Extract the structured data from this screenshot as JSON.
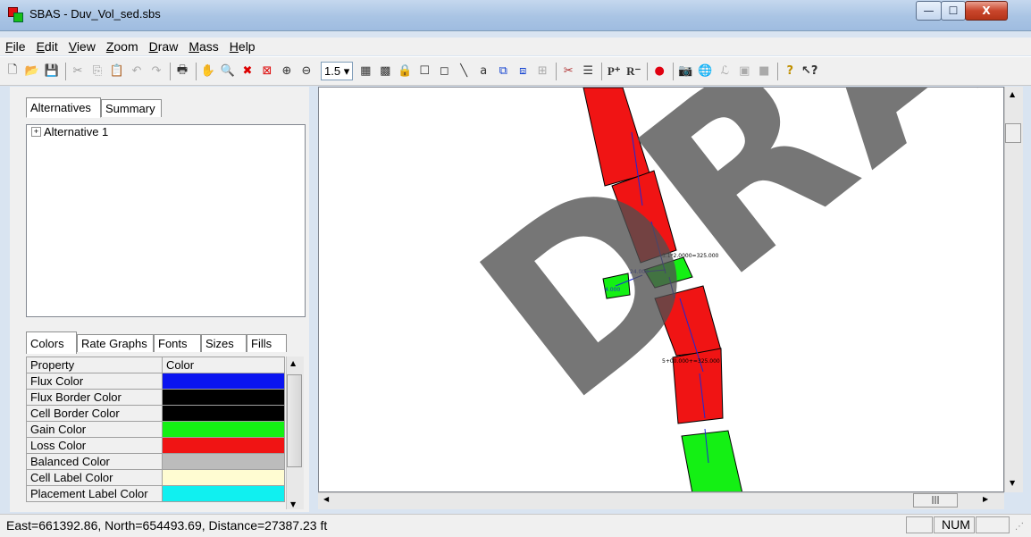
{
  "window": {
    "title": "SBAS - Duv_Vol_sed.sbs",
    "minimize_label": "—",
    "maximize_label": "☐",
    "close_label": "X"
  },
  "menu": [
    "File",
    "Edit",
    "View",
    "Zoom",
    "Draw",
    "Mass",
    "Help"
  ],
  "toolbar": {
    "zoom_value": "1.5",
    "tool_labels": {
      "text_tool": "a",
      "p_plus": "P⁺",
      "r_minus": "R⁻"
    }
  },
  "left_panel": {
    "top_tabs": [
      "Alternatives",
      "Summary"
    ],
    "tree": {
      "root": "Alternative 1",
      "expander": "+"
    },
    "bottom_tabs": [
      "Colors",
      "Rate Graphs",
      "Fonts",
      "Sizes",
      "Fills"
    ],
    "table_headers": [
      "Property",
      "Color"
    ],
    "rows": [
      {
        "property": "Flux Color",
        "color": "#0a14f0"
      },
      {
        "property": "Flux Border Color",
        "color": "#000000"
      },
      {
        "property": "Cell Border Color",
        "color": "#000000"
      },
      {
        "property": "Gain Color",
        "color": "#14f014"
      },
      {
        "property": "Loss Color",
        "color": "#f01414"
      },
      {
        "property": "Balanced Color",
        "color": "#bcbcbc"
      },
      {
        "property": "Cell Label Color",
        "color": "#fffcd2"
      },
      {
        "property": "Placement Label Color",
        "color": "#10f0f0"
      }
    ]
  },
  "canvas": {
    "cell_labels": [
      "3.1*2.0000=325.000",
      "5+00.000+=325.000",
      "24.000",
      "4.000"
    ],
    "watermark": "DRAFT"
  },
  "status": {
    "coords": "East=661392.86, North=654493.69, Distance=27387.23 ft",
    "num": "NUM"
  },
  "colors": {
    "loss": "#f01414",
    "gain": "#14f014",
    "flux": "#1a28d8"
  }
}
